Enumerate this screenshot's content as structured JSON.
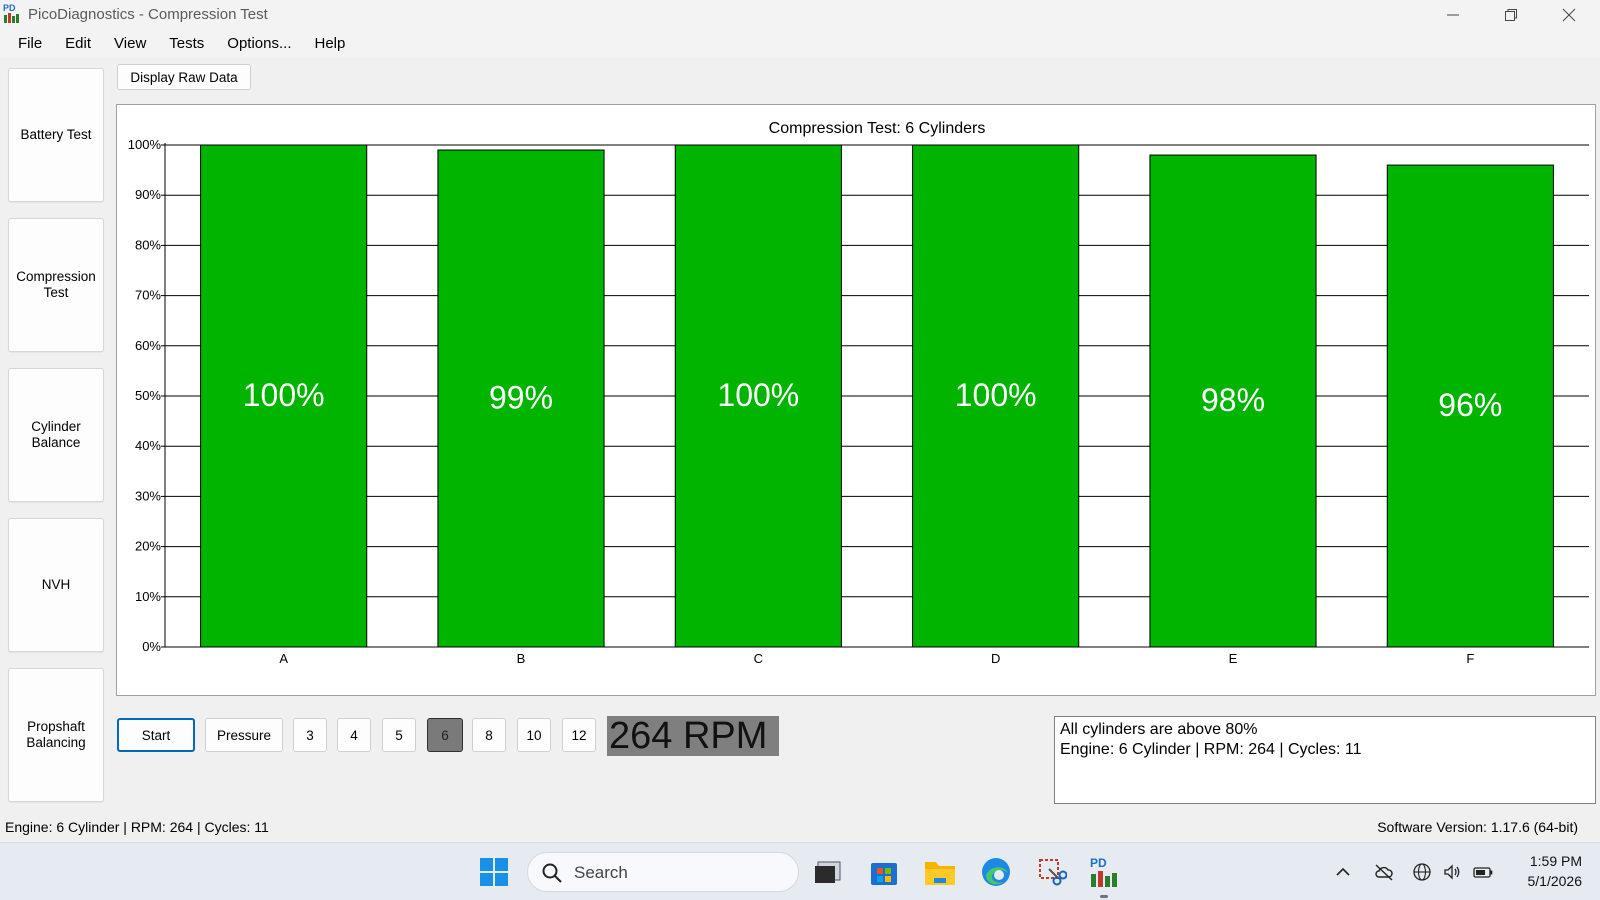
{
  "window": {
    "title": "PicoDiagnostics - Compression Test",
    "icon_label": "PD"
  },
  "menu": [
    "File",
    "Edit",
    "View",
    "Tests",
    "Options...",
    "Help"
  ],
  "sidebar": [
    {
      "label": "Battery Test"
    },
    {
      "label": "Compression\nTest"
    },
    {
      "label": "Cylinder\nBalance"
    },
    {
      "label": "NVH"
    },
    {
      "label": "Propshaft\nBalancing"
    }
  ],
  "toolbar": {
    "raw_data_label": "Display Raw Data"
  },
  "chart_data": {
    "type": "bar",
    "title": "Compression Test: 6 Cylinders",
    "categories": [
      "A",
      "B",
      "C",
      "D",
      "E",
      "F"
    ],
    "values": [
      100,
      99,
      100,
      100,
      98,
      96
    ],
    "data_labels": [
      "100%",
      "99%",
      "100%",
      "100%",
      "98%",
      "96%"
    ],
    "ylim": [
      0,
      100
    ],
    "yticks": [
      "0%",
      "10%",
      "20%",
      "30%",
      "40%",
      "50%",
      "60%",
      "70%",
      "80%",
      "90%",
      "100%"
    ],
    "grid": true,
    "bar_color": "#00b400"
  },
  "controls": {
    "start_label": "Start",
    "pressure_label": "Pressure",
    "cylinder_options": [
      "3",
      "4",
      "5",
      "6",
      "8",
      "10",
      "12"
    ],
    "selected_cylinders": "6",
    "rpm_display": "264 RPM"
  },
  "message": {
    "line1": "All cylinders are above 80%",
    "line2": "Engine: 6 Cylinder | RPM: 264 | Cycles: 11"
  },
  "status": {
    "left": "Engine: 6 Cylinder | RPM: 264 | Cycles: 11",
    "right": "Software Version: 1.17.6 (64-bit)"
  },
  "taskbar": {
    "search_placeholder": "Search",
    "time": "1:59 PM",
    "date": "5/1/2026",
    "pinned_pd_label": "PD"
  }
}
